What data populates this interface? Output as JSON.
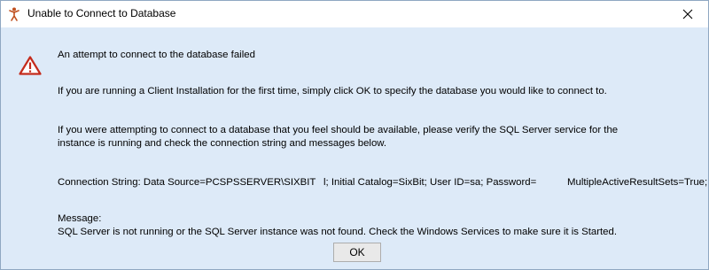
{
  "window": {
    "title": "Unable to Connect to Database",
    "close_glyph": "close-icon",
    "app_icon": "app-figure-icon",
    "background_color": "#ddeaf8",
    "titlebar_color": "#ffffff"
  },
  "content": {
    "icon": "warning-triangle-icon",
    "heading": "An attempt to connect to the database failed",
    "paragraph_client": "If you are running a Client Installation for the first time, simply click OK to specify the database you would like to connect to.",
    "paragraph_verify_line1": "If you were attempting to connect to a database that you feel should be available, please verify the SQL Server service for the",
    "paragraph_verify_line2": "instance is running and check the connection string and messages below.",
    "connection_string_part1": "Connection String: Data Source=PCSPSSERVER\\SIXBIT",
    "connection_string_part2": "l; Initial Catalog=SixBit; User ID=sa; Password=",
    "connection_string_part3": "MultipleActiveResultSets=True;",
    "message_label": "Message:",
    "message_text": "SQL Server is not running or the SQL Server instance was not found. Check the Windows Services to make sure it is Started."
  },
  "buttons": {
    "ok_label": "OK"
  }
}
